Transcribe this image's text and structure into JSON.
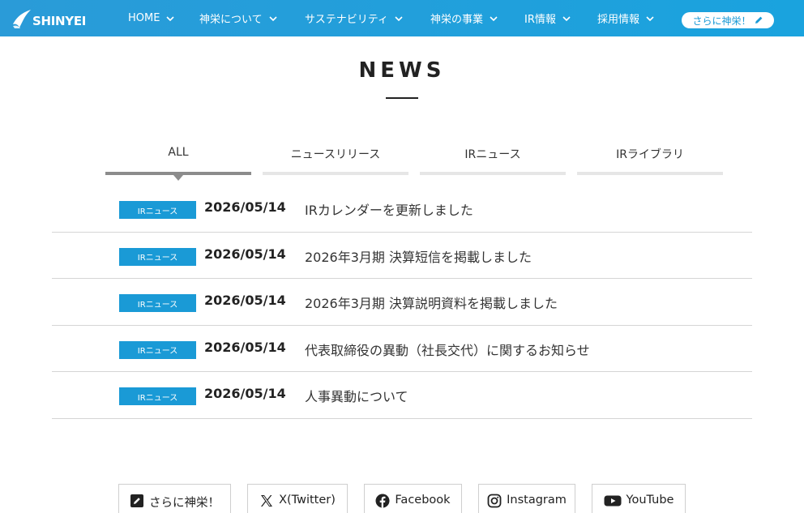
{
  "brand": {
    "logo_text": "SHINYEI",
    "primary_color": "#1a9ad6",
    "header_gradient": [
      "#2a9bd8",
      "#1aa3de"
    ]
  },
  "nav": {
    "items": [
      {
        "label": "HOME",
        "icon": "chevron-down-icon"
      },
      {
        "label": "神栄について",
        "icon": "chevron-down-icon"
      },
      {
        "label": "サステナビリティ",
        "icon": "chevron-down-icon"
      },
      {
        "label": "神栄の事業",
        "icon": "chevron-down-icon"
      },
      {
        "label": "IR情報",
        "icon": "chevron-down-icon"
      },
      {
        "label": "採用情報",
        "icon": "chevron-down-icon"
      }
    ],
    "more_button": {
      "label": "さらに神栄！",
      "icon": "pen-icon"
    }
  },
  "page": {
    "title": "NEWS"
  },
  "tabs": [
    {
      "label": "ALL",
      "active": true
    },
    {
      "label": "ニュースリリース",
      "active": false
    },
    {
      "label": "IRニュース",
      "active": false
    },
    {
      "label": "IRライブラリ",
      "active": false
    }
  ],
  "news": [
    {
      "category": "IRニュース",
      "date": "2026/05/14",
      "title": "IRカレンダーを更新しました"
    },
    {
      "category": "IRニュース",
      "date": "2026/05/14",
      "title": "2026年3月期 決算短信を掲載しました"
    },
    {
      "category": "IRニュース",
      "date": "2026/05/14",
      "title": "2026年3月期 決算説明資料を掲載しました"
    },
    {
      "category": "IRニュース",
      "date": "2026/05/14",
      "title": "代表取締役の異動（社長交代）に関するお知らせ"
    },
    {
      "category": "IRニュース",
      "date": "2026/05/14",
      "title": "人事異動について"
    }
  ],
  "social": [
    {
      "label": "さらに神栄！",
      "icon": "pen-icon"
    },
    {
      "label": "X(Twitter)",
      "icon": "x-icon"
    },
    {
      "label": "Facebook",
      "icon": "facebook-icon"
    },
    {
      "label": "Instagram",
      "icon": "instagram-icon"
    },
    {
      "label": "YouTube",
      "icon": "youtube-icon"
    }
  ]
}
